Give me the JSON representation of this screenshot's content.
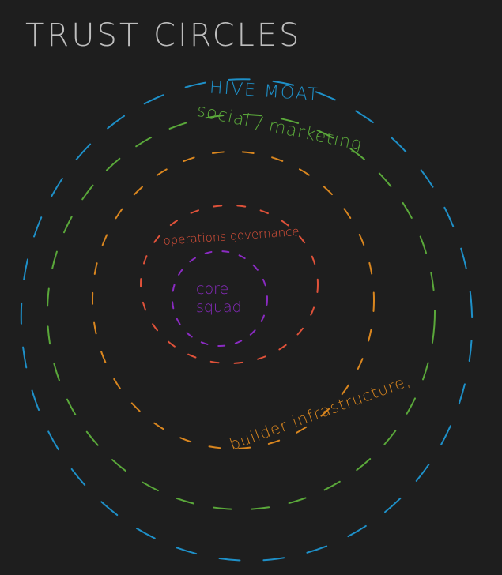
{
  "title": "TRUST CIRCLES",
  "colors": {
    "background": "#1e1e1e",
    "title": "#bdbdbd",
    "hive_moat": "#1e90c8",
    "social_marketing": "#5aa83a",
    "builder_infrastructure": "#d9861f",
    "operations_governance": "#e0523a",
    "core_squad": "#8a2bc2"
  },
  "rings": [
    {
      "key": "hive_moat",
      "label": "HIVE MOAT"
    },
    {
      "key": "social_marketing",
      "label": "social / marketing"
    },
    {
      "key": "builder_infrastructure",
      "label": "builder infrastructure,"
    },
    {
      "key": "operations_governance",
      "label": "operations governance"
    },
    {
      "key": "core_squad",
      "label_line1": "core",
      "label_line2": "squad"
    }
  ]
}
